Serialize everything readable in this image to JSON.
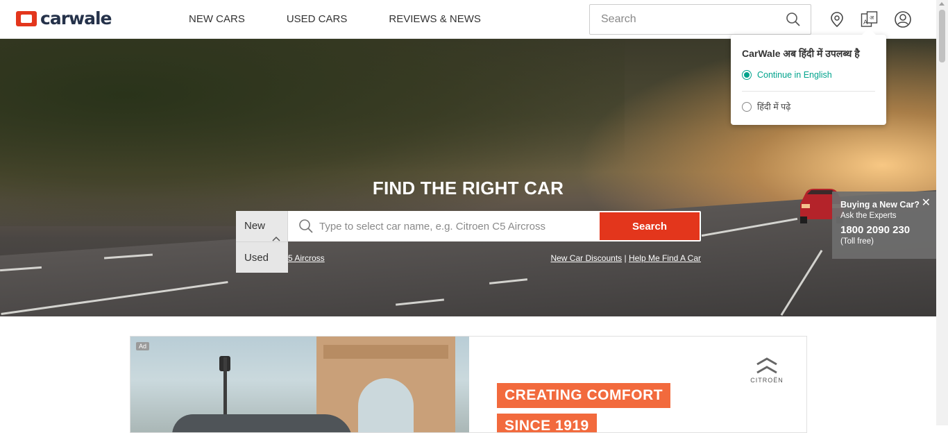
{
  "header": {
    "logo_text": "carwale",
    "nav": [
      "NEW CARS",
      "USED CARS",
      "REVIEWS & NEWS"
    ],
    "search_placeholder": "Search",
    "icons": [
      "location-icon",
      "language-icon",
      "user-account-icon"
    ]
  },
  "language_popup": {
    "title": "CarWale अब हिंदी में उपलब्ध है",
    "option_english": "Continue in English",
    "option_hindi": "हिंदी में पढ़े",
    "selected": "Continue in English"
  },
  "hero": {
    "title": "FIND THE RIGHT CAR",
    "type_selected": "New",
    "type_options": [
      "Used"
    ],
    "search_placeholder": "Type to select car name, e.g. Citroen C5 Aircross",
    "search_button": "Search",
    "suggestion_partial": "5 Aircross",
    "link_discounts": "New Car Discounts",
    "separator": " | ",
    "link_help": "Help Me Find A Car"
  },
  "experts": {
    "heading": "Buying a New Car?",
    "subheading": "Ask the Experts",
    "phone": "1800 2090 230",
    "note": "(Toll free)",
    "close_symbol": "✕"
  },
  "ad": {
    "badge": "Ad",
    "headline_line1": "CREATING COMFORT",
    "headline_line2": "SINCE 1919",
    "brand": "CITROËN"
  },
  "colors": {
    "brand_red": "#e3361c",
    "accent_teal": "#00a38c",
    "ad_orange": "#f26a3d"
  }
}
